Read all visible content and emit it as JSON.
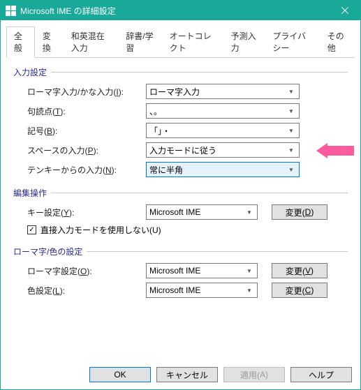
{
  "window": {
    "title": "Microsoft IME の詳細設定"
  },
  "tabs": [
    "全般",
    "変換",
    "和英混在入力",
    "辞書/学習",
    "オートコレクト",
    "予測入力",
    "プライバシー",
    "その他"
  ],
  "active_tab": 0,
  "groups": {
    "input": {
      "title": "入力設定",
      "rows": [
        {
          "label_pre": "ローマ字入力/かな入力(",
          "key": "I",
          "label_post": "):",
          "value": "ローマ字入力"
        },
        {
          "label_pre": "句読点(",
          "key": "T",
          "label_post": "):",
          "value": "、。"
        },
        {
          "label_pre": "記号(",
          "key": "B",
          "label_post": "):",
          "value": "「」・"
        },
        {
          "label_pre": "スペースの入力(",
          "key": "P",
          "label_post": "):",
          "value": "入力モードに従う"
        },
        {
          "label_pre": "テンキーからの入力(",
          "key": "N",
          "label_post": "):",
          "value": "常に半角",
          "highlight": true
        }
      ]
    },
    "edit": {
      "title": "編集操作",
      "rows": [
        {
          "label_pre": "キー設定(",
          "key": "Y",
          "label_post": "):",
          "value": "Microsoft IME",
          "button_pre": "変更(",
          "button_key": "D",
          "button_post": ")"
        }
      ],
      "checkbox": {
        "checked": true,
        "label_pre": "直接入力モードを使用しない(",
        "key": "U",
        "label_post": ")"
      }
    },
    "romaji": {
      "title": "ローマ字/色の設定",
      "rows": [
        {
          "label_pre": "ローマ字設定(",
          "key": "O",
          "label_post": "):",
          "value": "Microsoft IME",
          "button_pre": "変更(",
          "button_key": "V",
          "button_post": ")"
        },
        {
          "label_pre": "色設定(",
          "key": "L",
          "label_post": "):",
          "value": "Microsoft IME",
          "button_pre": "変更(",
          "button_key": "C",
          "button_post": ")"
        }
      ]
    }
  },
  "footer": {
    "ok": "OK",
    "cancel": "キャンセル",
    "apply_pre": "適用(",
    "apply_key": "A",
    "apply_post": ")",
    "help": "ヘルプ"
  }
}
